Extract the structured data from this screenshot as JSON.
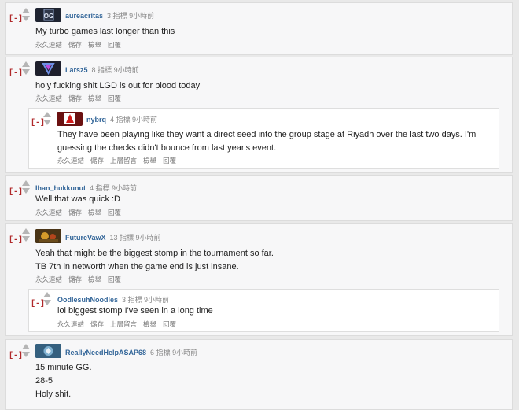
{
  "toggle_label": "[-]",
  "comments": [
    {
      "author": "aureacritas",
      "points": "3 指標",
      "time": "9小時前",
      "lines": [
        "My turbo games last longer than this"
      ],
      "links": [
        "永久連結",
        "儲存",
        "檢舉",
        "回覆"
      ]
    },
    {
      "author": "Larsz5",
      "points": "8 指標",
      "time": "9小時前",
      "lines": [
        "holy fucking shit LGD is out for blood today"
      ],
      "links": [
        "永久連結",
        "儲存",
        "檢舉",
        "回覆"
      ]
    },
    {
      "author": "nybrq",
      "points": "4 指標",
      "time": "9小時前",
      "lines": [
        "They have been playing like they want a direct seed into the group stage at Riyadh over the last two days. I'm",
        "guessing the checks didn't bounce from last year's event."
      ],
      "links": [
        "永久連結",
        "儲存",
        "上層留言",
        "檢舉",
        "回覆"
      ]
    },
    {
      "author": "Ihan_hukkunut",
      "points": "4 指標",
      "time": "9小時前",
      "lines": [
        "Well that was quick :D"
      ],
      "links": [
        "永久連結",
        "儲存",
        "檢舉",
        "回覆"
      ]
    },
    {
      "author": "FutureVawX",
      "points": "13 指標",
      "time": "9小時前",
      "lines": [
        "Yeah that might be the biggest stomp in the tournament so far.",
        "TB 7th in networth when the game end is just insane."
      ],
      "links": [
        "永久連結",
        "儲存",
        "檢舉",
        "回覆"
      ]
    },
    {
      "author": "OodlesuhNoodles",
      "points": "3 指標",
      "time": "9小時前",
      "lines": [
        "lol biggest stomp I've seen in a long time"
      ],
      "links": [
        "永久連結",
        "儲存",
        "上層留言",
        "檢舉",
        "回覆"
      ]
    },
    {
      "author": "ReallyNeedHelpASAP68",
      "points": "6 指標",
      "time": "9小時前",
      "lines": [
        "15 minute GG.",
        "28-5",
        "Holy shit."
      ],
      "links": []
    }
  ]
}
